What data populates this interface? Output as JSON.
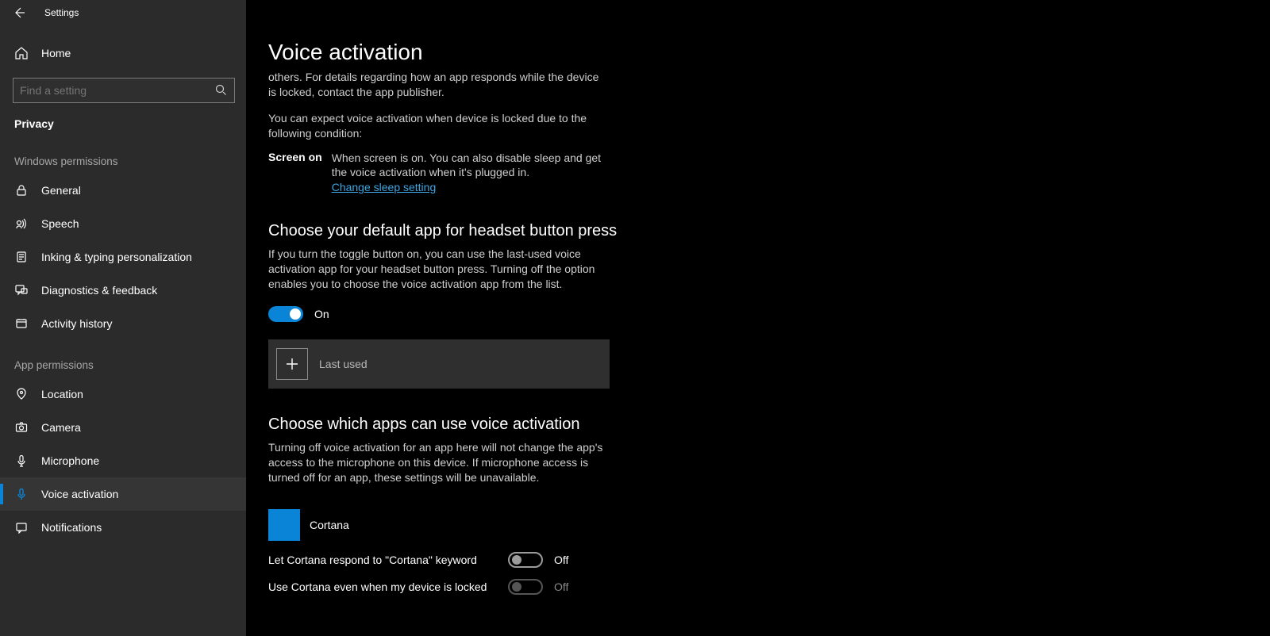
{
  "window": {
    "title": "Settings"
  },
  "sidebar": {
    "home": "Home",
    "search_placeholder": "Find a setting",
    "category": "Privacy",
    "group1_header": "Windows permissions",
    "group1": [
      "General",
      "Speech",
      "Inking & typing personalization",
      "Diagnostics & feedback",
      "Activity history"
    ],
    "group2_header": "App permissions",
    "group2": [
      "Location",
      "Camera",
      "Microphone",
      "Voice activation",
      "Notifications"
    ]
  },
  "main": {
    "title": "Voice activation",
    "p_cut": "others. For details regarding how an app responds while the device is locked, contact the app publisher.",
    "p_expect": "You can expect voice activation when device is locked due to the following condition:",
    "screen_on_label": "Screen on",
    "screen_on_text": "When screen is on. You can also disable sleep and get the voice activation when it's plugged in.",
    "sleep_link": "Change sleep setting",
    "headset_h": "Choose your default app for headset button press",
    "headset_p": "If you turn the toggle button on, you can use the last-used voice activation app for your headset button press. Turning off the option enables you to choose the voice activation app from the list.",
    "headset_toggle_state": "On",
    "selector_label": "Last used",
    "apps_h": "Choose which apps can use voice activation",
    "apps_p": "Turning off voice activation for an app here will not change the app's access to the microphone on this device. If microphone access is turned off for an app, these settings will be unavailable.",
    "cortana_name": "Cortana",
    "cortana_keyword_lbl": "Let Cortana respond to \"Cortana\" keyword",
    "cortana_keyword_state": "Off",
    "cortana_locked_lbl": "Use Cortana even when my device is locked",
    "cortana_locked_state": "Off"
  }
}
